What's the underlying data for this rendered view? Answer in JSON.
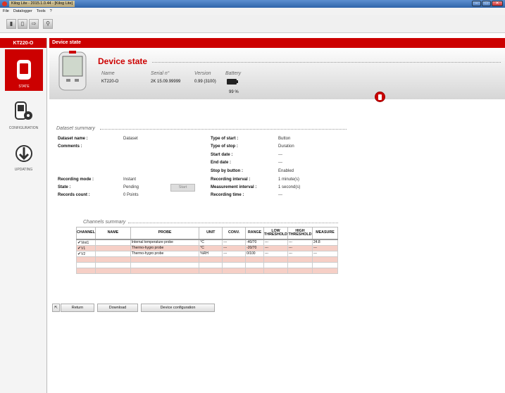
{
  "window": {
    "title": "Kilog Lite - 2015.1.0.44 - [Kilog Lite]",
    "min": "–",
    "max": "□",
    "close": "✕"
  },
  "menu": [
    "File",
    "Datalogger",
    "Tools",
    "?"
  ],
  "sidebar": {
    "device": "KT220-O",
    "items": [
      {
        "label": "STATE",
        "icon": "datalogger-icon"
      },
      {
        "label": "CONFIGURATION",
        "icon": "config-gear-icon"
      },
      {
        "label": "UPDATING",
        "icon": "update-download-icon"
      }
    ]
  },
  "main": {
    "header": "Device state"
  },
  "device": {
    "title": "Device state",
    "name_h": "Name",
    "serial_h": "Serial n°",
    "version_h": "Version",
    "battery_h": "Battery",
    "name": "KT220-O",
    "serial": "2K 15.09.99999",
    "version": "0.99 (3100)",
    "battery": "99 %"
  },
  "dataset": {
    "title": "Dataset summary",
    "left": [
      {
        "label": "Dataset name :",
        "value": "Dataset"
      },
      {
        "label": "Comments :",
        "value": ""
      },
      {
        "label": "Recording mode :",
        "value": "Instant"
      },
      {
        "label": "State :",
        "value": "Pending"
      },
      {
        "label": "Records count :",
        "value": "0 Points"
      }
    ],
    "right": [
      {
        "label": "Type of start :",
        "value": "Button"
      },
      {
        "label": "Type of stop :",
        "value": "Duration"
      },
      {
        "label": "Start date :",
        "value": "---"
      },
      {
        "label": "End date :",
        "value": "---"
      },
      {
        "label": "Stop by button :",
        "value": "Enabled"
      },
      {
        "label": "Recording interval :",
        "value": "1 minute(s)"
      },
      {
        "label": "Measurement interval :",
        "value": "1 second(s)"
      },
      {
        "label": "Recording time :",
        "value": "---"
      }
    ],
    "start_button": "Start"
  },
  "channels": {
    "title": "Channels summary",
    "headers": [
      "CHANNEL",
      "NAME",
      "PROBE",
      "UNIT",
      "CONV.",
      "RANGE",
      "LOW THRESHOLD",
      "HIGH THRESHOLD",
      "MEASURE"
    ],
    "rows": [
      [
        "Vint1",
        "",
        "Internal temperature probe",
        "°C",
        "---",
        "-40/70",
        "---",
        "---",
        "24.8"
      ],
      [
        "V1",
        "",
        "Thermo-hygro probe",
        "°C",
        "---",
        "-20/70",
        "---",
        "---",
        "---"
      ],
      [
        "V2",
        "",
        "Thermo-hygro probe",
        "%RH",
        "---",
        "0/100",
        "---",
        "---",
        "---"
      ]
    ],
    "check": "✔"
  },
  "buttons": {
    "return": "Return",
    "download": "Download",
    "config": "Device configuration"
  }
}
